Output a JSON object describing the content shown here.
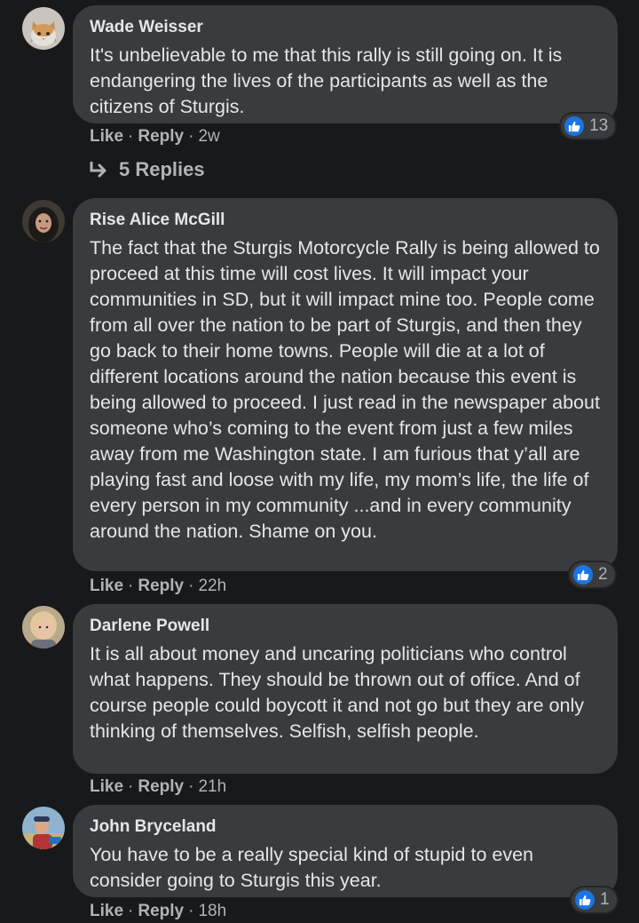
{
  "comments": [
    {
      "author": "Wade Weisser",
      "text": "It's unbelievable to me that this rally is still going on. It is endangering the lives of the participants as well as the citizens of Sturgis.",
      "like_label": "Like",
      "reply_label": "Reply",
      "time": "2w",
      "reactions": "13",
      "avatar_icon": "cat-avatar"
    },
    {
      "author": "Rise Alice McGill",
      "text": "The fact that the Sturgis Motorcycle Rally is being allowed to proceed at this time will cost lives. It will impact your communities in SD, but it will impact mine too. People come from all over the nation to be part of Sturgis, and then they go back to their home towns. People will die at a lot of different locations around the nation because this event is being allowed to proceed. I just read in the newspaper about someone who’s coming to the event from just a few miles away from me Washington state. I am furious that y’all are playing fast and loose with my life, my mom’s life, the life of every person in my community ...and in every community around the nation. Shame on you.",
      "like_label": "Like",
      "reply_label": "Reply",
      "time": "22h",
      "reactions": "2",
      "avatar_icon": "woman-avatar"
    },
    {
      "author": "Darlene Powell",
      "text": "It is all about money and uncaring politicians who control what happens. They should be thrown out of office. And of course people could boycott it and not go but they are only thinking of themselves. Selfish, selfish people.",
      "like_label": "Like",
      "reply_label": "Reply",
      "time": "21h",
      "avatar_icon": "woman-avatar"
    },
    {
      "author": "John Bryceland",
      "text": "You have to be a really special kind of stupid to even consider going to Sturgis this year.",
      "like_label": "Like",
      "reply_label": "Reply",
      "time": "18h",
      "reactions": "1",
      "avatar_icon": "man-avatar"
    }
  ],
  "replies_link": "5 Replies",
  "colors": {
    "background": "#18191a",
    "bubble": "#3a3b3c",
    "text": "#e4e6eb",
    "secondary": "#b0b3b8",
    "like_blue": "#1b74e4"
  }
}
